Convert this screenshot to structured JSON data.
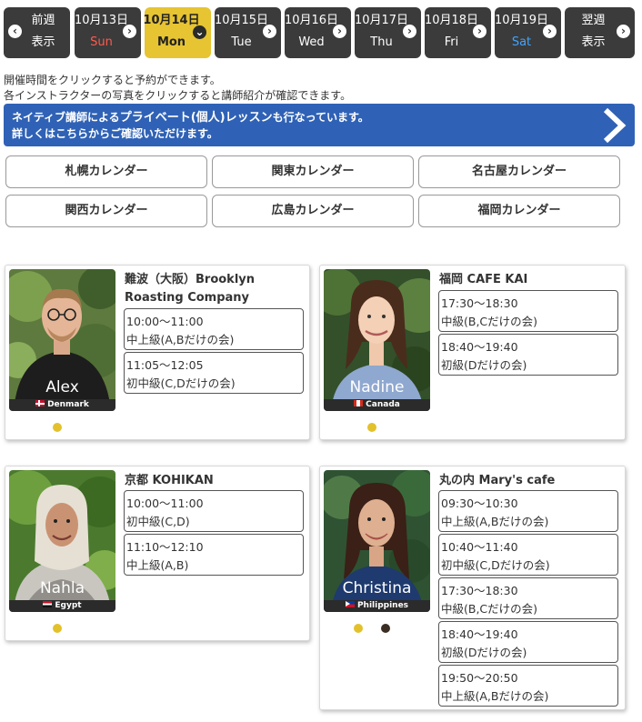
{
  "datebar": {
    "prev": {
      "l1": "前週",
      "l2": "表示"
    },
    "days": [
      {
        "date": "10月13日",
        "dow": "Sun",
        "tone": "red"
      },
      {
        "date": "10月14日",
        "dow": "Mon",
        "tone": "selected"
      },
      {
        "date": "10月15日",
        "dow": "Tue",
        "tone": "normal"
      },
      {
        "date": "10月16日",
        "dow": "Wed",
        "tone": "normal"
      },
      {
        "date": "10月17日",
        "dow": "Thu",
        "tone": "normal"
      },
      {
        "date": "10月18日",
        "dow": "Fri",
        "tone": "normal"
      },
      {
        "date": "10月19日",
        "dow": "Sat",
        "tone": "blue"
      }
    ],
    "next": {
      "l1": "翌週",
      "l2": "表示"
    }
  },
  "info": {
    "line1": "開催時間をクリックすると予約ができます。",
    "line2": "各インストラクターの写真をクリックすると講師紹介が確認できます。"
  },
  "banner": {
    "line1_a": "ネイティブ講師による",
    "line1_b": "プライベート(個人)レッスン",
    "line1_c": "も行なっています。",
    "line2": "詳しくはこちらからご確認いただけます。"
  },
  "regions": [
    "札幌カレンダー",
    "関東カレンダー",
    "名古屋カレンダー",
    "関西カレンダー",
    "広島カレンダー",
    "福岡カレンダー"
  ],
  "cards": [
    {
      "name": "Alex",
      "country": "Denmark",
      "venue": "難波（大阪）Brooklyn Roasting Company",
      "slots": [
        {
          "time": "10:00〜11:00",
          "level": "中上級(A,Bだけの会)"
        },
        {
          "time": "11:05〜12:05",
          "level": "初中級(C,Dだけの会)"
        }
      ]
    },
    {
      "name": "Nadine",
      "country": "Canada",
      "venue": "福岡 CAFE KAI",
      "slots": [
        {
          "time": "17:30〜18:30",
          "level": "中級(B,Cだけの会)"
        },
        {
          "time": "18:40〜19:40",
          "level": "初級(Dだけの会)"
        }
      ]
    },
    {
      "name": "Nahla",
      "country": "Egypt",
      "venue": "京都 KOHIKAN",
      "slots": [
        {
          "time": "10:00〜11:00",
          "level": "初中級(C,D)"
        },
        {
          "time": "11:10〜12:10",
          "level": "中上級(A,B)"
        }
      ]
    },
    {
      "name": "Christina",
      "country": "Philippines",
      "venue": "丸の内 Mary's cafe",
      "slots": [
        {
          "time": "09:30〜10:30",
          "level": "中上級(A,Bだけの会)"
        },
        {
          "time": "10:40〜11:40",
          "level": "初中級(C,Dだけの会)"
        },
        {
          "time": "17:30〜18:30",
          "level": "中級(B,Cだけの会)"
        },
        {
          "time": "18:40〜19:40",
          "level": "初級(Dだけの会)"
        },
        {
          "time": "19:50〜20:50",
          "level": "中上級(A,Bだけの会)"
        }
      ]
    }
  ],
  "colors": {
    "nav_bg": "#3b3b3b",
    "selected_day": "#e7c431",
    "banner": "#2f62b6",
    "sunday": "#ff5a4e",
    "saturday": "#3fa4ff",
    "dot": "#e3c12b"
  }
}
